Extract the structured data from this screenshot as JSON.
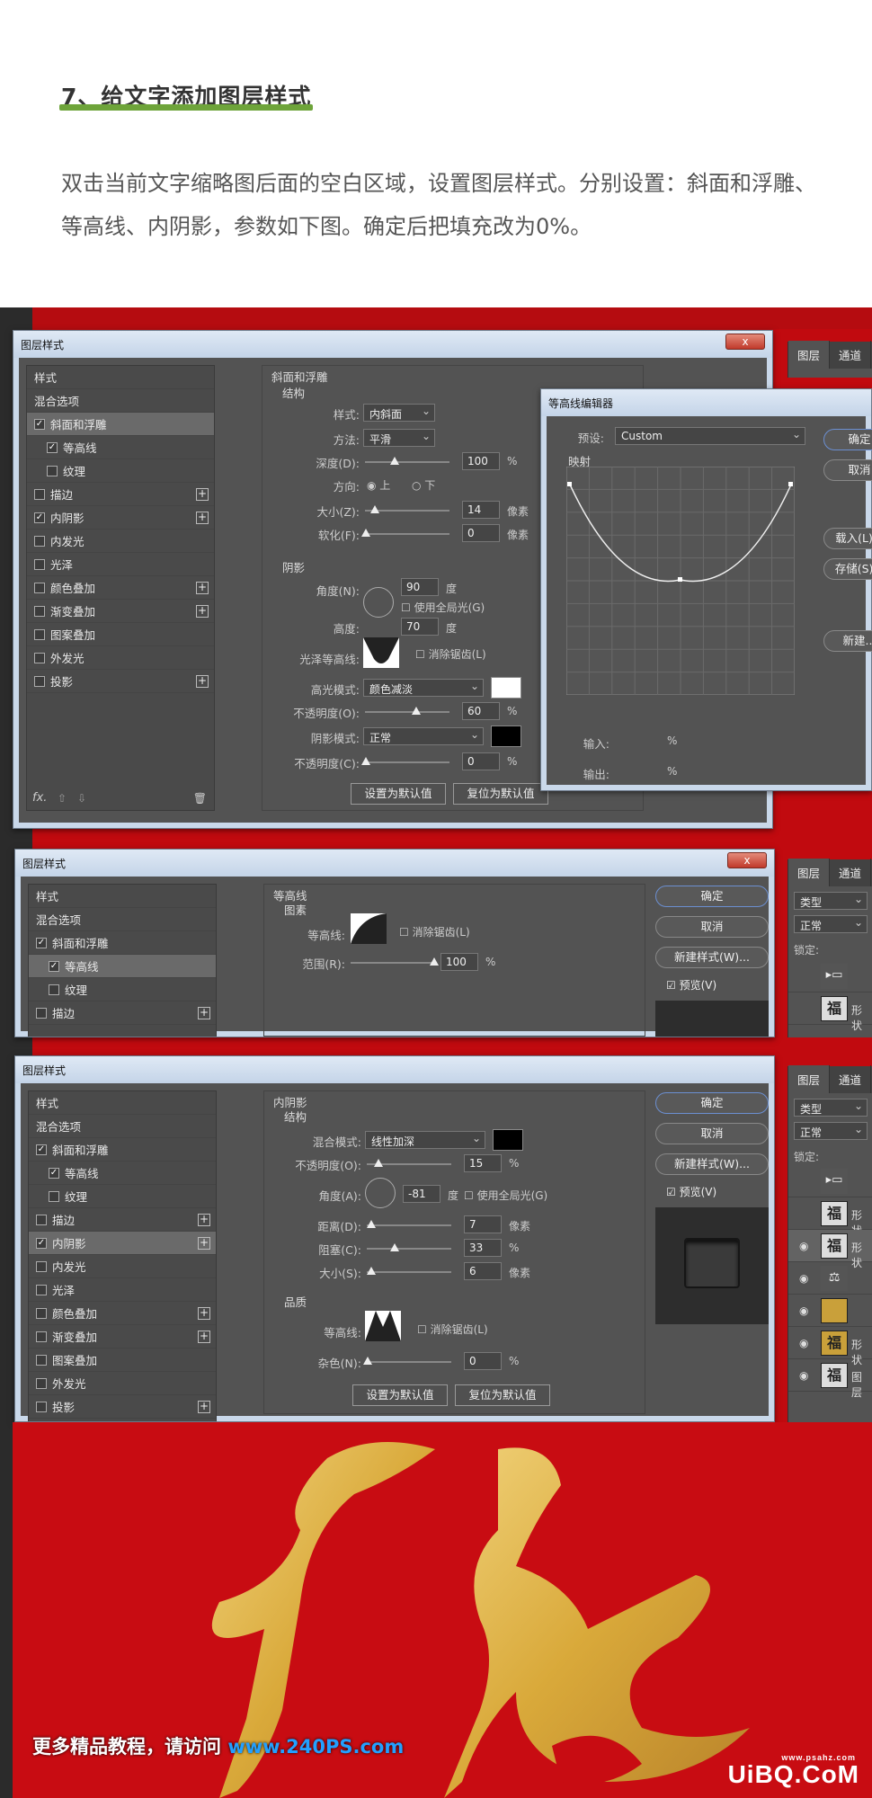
{
  "article": {
    "heading": "7、给文字添加图层样式",
    "paragraph": "双击当前文字缩略图后面的空白区域，设置图层样式。分别设置：斜面和浮雕、等高线、内阴影，参数如下图。确定后把填充改为0%。"
  },
  "colors": {
    "accent": "#6ea43a",
    "stage": "#c10a0f",
    "panel": "#535353",
    "gold": "#d9a93a"
  },
  "common": {
    "dialog_title": "图层样式",
    "close": "x",
    "list": [
      "样式",
      "混合选项",
      "斜面和浮雕",
      "等高线",
      "纹理",
      "描边",
      "内阴影",
      "内发光",
      "光泽",
      "颜色叠加",
      "渐变叠加",
      "图案叠加",
      "外发光",
      "投影"
    ],
    "ok": "确定",
    "cancel": "取消",
    "new_style": "新建样式(W)...",
    "preview": "预览(V)",
    "make_default": "设置为默认值",
    "reset_default": "复位为默认值",
    "antialias": "消除锯齿(L)",
    "unit_px": "像素",
    "unit_pct": "%",
    "unit_deg": "度",
    "global_light": "使用全局光(G)",
    "layers_tab": "图层",
    "channels_tab": "通道",
    "kind_search": "类型",
    "blend_normal": "正常",
    "lock": "锁定:",
    "layer_name_shape": "形状",
    "layer_name_img": "图层"
  },
  "bevel": {
    "section": "斜面和浮雕",
    "structure": "结构",
    "style_label": "样式:",
    "style_value": "内斜面",
    "method_label": "方法:",
    "method_value": "平滑",
    "depth_label": "深度(D):",
    "depth_value": "100",
    "direction_label": "方向:",
    "dir_up": "上",
    "dir_down": "下",
    "size_label": "大小(Z):",
    "size_value": "14",
    "soften_label": "软化(F):",
    "soften_value": "0",
    "shading": "阴影",
    "angle_label": "角度(N):",
    "angle_value": "90",
    "altitude_label": "高度:",
    "altitude_value": "70",
    "gloss_label": "光泽等高线:",
    "hl_mode_label": "高光模式:",
    "hl_mode_value": "颜色减淡",
    "hl_opacity_label": "不透明度(O):",
    "hl_opacity_value": "60",
    "sh_mode_label": "阴影模式:",
    "sh_mode_value": "正常",
    "sh_opacity_label": "不透明度(C):",
    "sh_opacity_value": "0",
    "fx": "fx."
  },
  "contour_editor": {
    "title": "等高线编辑器",
    "preset_label": "预设:",
    "preset_value": "Custom",
    "mapping": "映射",
    "input": "输入:",
    "output": "输出:",
    "pct": "%",
    "ok": "确定",
    "cancel": "取消",
    "load": "载入(L)...",
    "save": "存储(S)...",
    "new": "新建..."
  },
  "contour": {
    "section": "等高线",
    "element": "图素",
    "contour_label": "等高线:",
    "range_label": "范围(R):",
    "range_value": "100"
  },
  "inner_shadow": {
    "section": "内阴影",
    "structure": "结构",
    "blend_label": "混合模式:",
    "blend_value": "线性加深",
    "opacity_label": "不透明度(O):",
    "opacity_value": "15",
    "angle_label": "角度(A):",
    "angle_value": "-81",
    "distance_label": "距离(D):",
    "distance_value": "7",
    "choke_label": "阻塞(C):",
    "choke_value": "33",
    "size_label": "大小(S):",
    "size_value": "6",
    "quality": "品质",
    "contour_label": "等高线:",
    "noise_label": "杂色(N):",
    "noise_value": "0"
  },
  "footer": {
    "text": "更多精品教程，请访问 ",
    "url": "www.240PS.com",
    "brand": "UiBQ.CoM",
    "watermark": "www.psahz.com"
  }
}
